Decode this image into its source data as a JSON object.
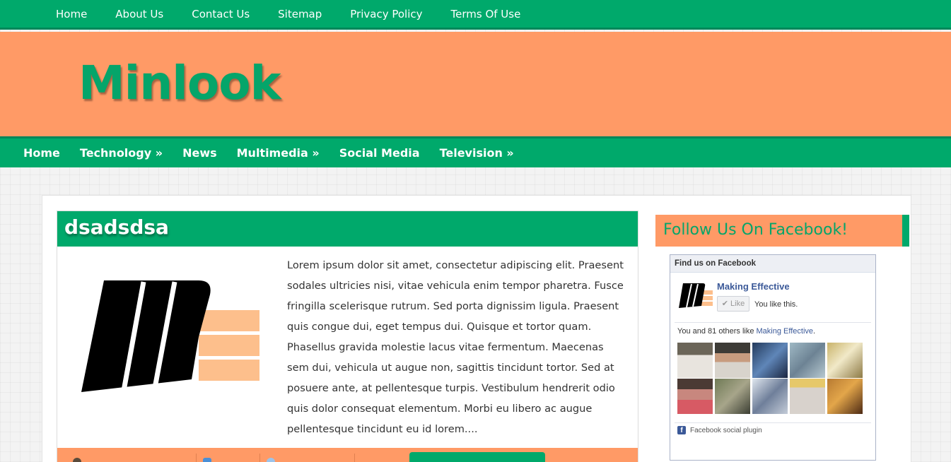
{
  "top_nav": [
    "Home",
    "About Us",
    "Contact Us",
    "Sitemap",
    "Privacy Policy",
    "Terms Of Use"
  ],
  "header": {
    "logo_text": "Minlook"
  },
  "main_nav": [
    "Home",
    "Technology »",
    "News",
    "Multimedia »",
    "Social Media",
    "Television »"
  ],
  "post": {
    "title": "dsadsdsa",
    "excerpt": "Lorem ipsum dolor sit amet, consectetur adipiscing elit. Praesent sodales ultricies nisi, vitae vehicula enim tempor pharetra. Fusce fringilla scelerisque rutrum. Sed porta dignissim ligula. Praesent quis congue dui, eget tempus dui. Quisque et tortor quam. Phasellus gravida molestie lacus vitae fermentum. Maecenas sem dui, vehicula ut augue non, sagittis tincidunt tortor. Sed at posuere ante, at pellentesque turpis. Vestibulum hendrerit odio quis dolor consequat elementum. Morbi eu libero ac augue pellentesque tincidunt eu id lorem....",
    "meta_icons": [
      "author-icon",
      "calendar-icon",
      "comment-icon"
    ]
  },
  "sidebar": {
    "widget_title": "Follow Us On Facebook!",
    "fb": {
      "header": "Find us on Facebook",
      "page_name": "Making Effective",
      "like_label": "Like",
      "you_like": "You like this.",
      "count_prefix": "You and 81 others like",
      "count_link": "Making Effective",
      "count_suffix": ".",
      "plugin_label": "Facebook social plugin"
    }
  },
  "colors": {
    "green": "#00a96b",
    "orange": "#ff9a66",
    "fb_blue": "#3b5998"
  }
}
